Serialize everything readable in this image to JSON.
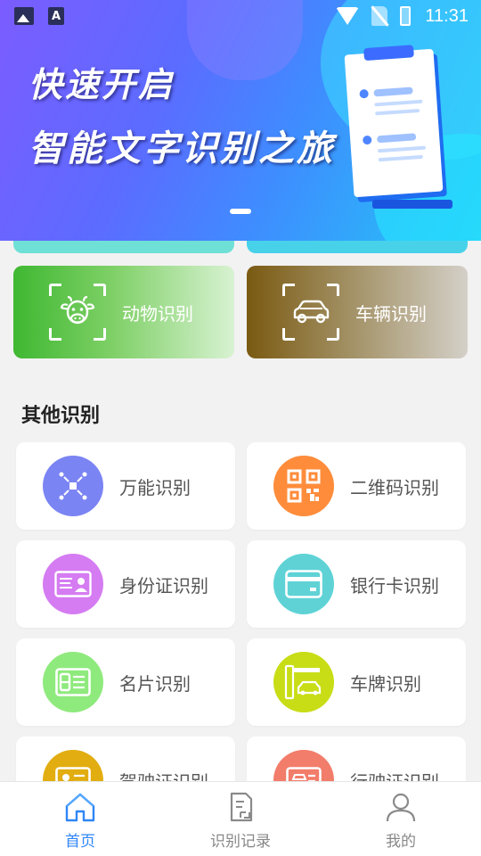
{
  "status_bar": {
    "time": "11:31"
  },
  "banner": {
    "title_line1": "快速开启",
    "title_line2": "智能文字识别之旅"
  },
  "featured": [
    {
      "label": "动物识别",
      "icon": "cow-icon"
    },
    {
      "label": "车辆识别",
      "icon": "car-icon"
    }
  ],
  "section": {
    "title": "其他识别"
  },
  "items": [
    {
      "label": "万能识别",
      "icon": "scan-target-icon",
      "color": "#7b84f3"
    },
    {
      "label": "二维码识别",
      "icon": "qr-code-icon",
      "color": "#ff8c3b"
    },
    {
      "label": "身份证识别",
      "icon": "id-card-icon",
      "color": "#d57cf2"
    },
    {
      "label": "银行卡识别",
      "icon": "bank-card-icon",
      "color": "#5fd2d6"
    },
    {
      "label": "名片识别",
      "icon": "business-card-icon",
      "color": "#8fea7d"
    },
    {
      "label": "车牌识别",
      "icon": "license-plate-icon",
      "color": "#c8dd16"
    },
    {
      "label": "驾驶证识别",
      "icon": "driver-license-icon",
      "color": "#e2ad10"
    },
    {
      "label": "行驶证识别",
      "icon": "vehicle-license-icon",
      "color": "#f27d6a"
    }
  ],
  "bottom_nav": [
    {
      "label": "首页",
      "icon": "home-icon",
      "active": true
    },
    {
      "label": "识别记录",
      "icon": "records-icon",
      "active": false
    },
    {
      "label": "我的",
      "icon": "profile-icon",
      "active": false
    }
  ],
  "colors": {
    "accent": "#2f86f6",
    "animal_card": "#3fb832",
    "vehicle_card": "#7a5a12"
  }
}
